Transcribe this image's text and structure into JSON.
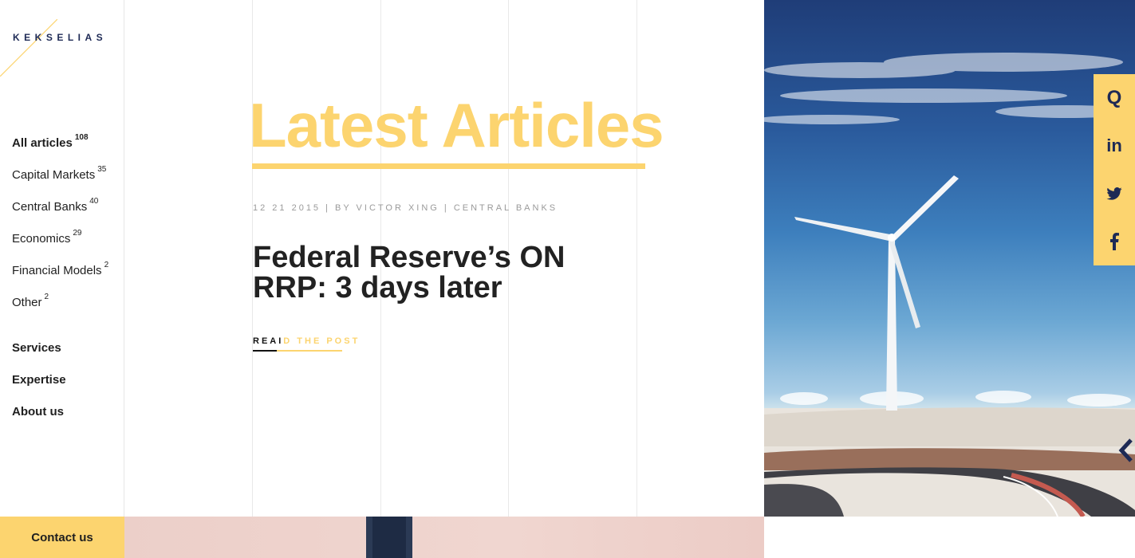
{
  "brand": {
    "name": "KEKSELIAS",
    "accent": "#fcd46f",
    "navy": "#1e2a55"
  },
  "sidebar": {
    "categories": [
      {
        "label": "All articles",
        "count": "108"
      },
      {
        "label": "Capital Markets",
        "count": "35"
      },
      {
        "label": "Central Banks",
        "count": "40"
      },
      {
        "label": "Economics",
        "count": "29"
      },
      {
        "label": "Financial Models",
        "count": "2"
      },
      {
        "label": "Other",
        "count": "2"
      }
    ],
    "links": [
      "Services",
      "Expertise",
      "About us"
    ],
    "contact_label": "Contact us"
  },
  "main": {
    "heading": "Latest Articles",
    "post": {
      "meta": "12 21 2015 | BY VICTOR XING | CENTRAL BANKS",
      "title": "Federal Reserve’s ON RRP: 3 days later",
      "read_dark": "REAI",
      "read_light": "D THE POST",
      "read_progress": 0.27
    }
  },
  "social": {
    "icons": [
      "search-icon",
      "linkedin-icon",
      "twitter-icon",
      "facebook-icon"
    ],
    "search_glyph": "Q",
    "linkedin_glyph": "in"
  },
  "hero": {
    "icon": "wind-turbine-photo"
  }
}
